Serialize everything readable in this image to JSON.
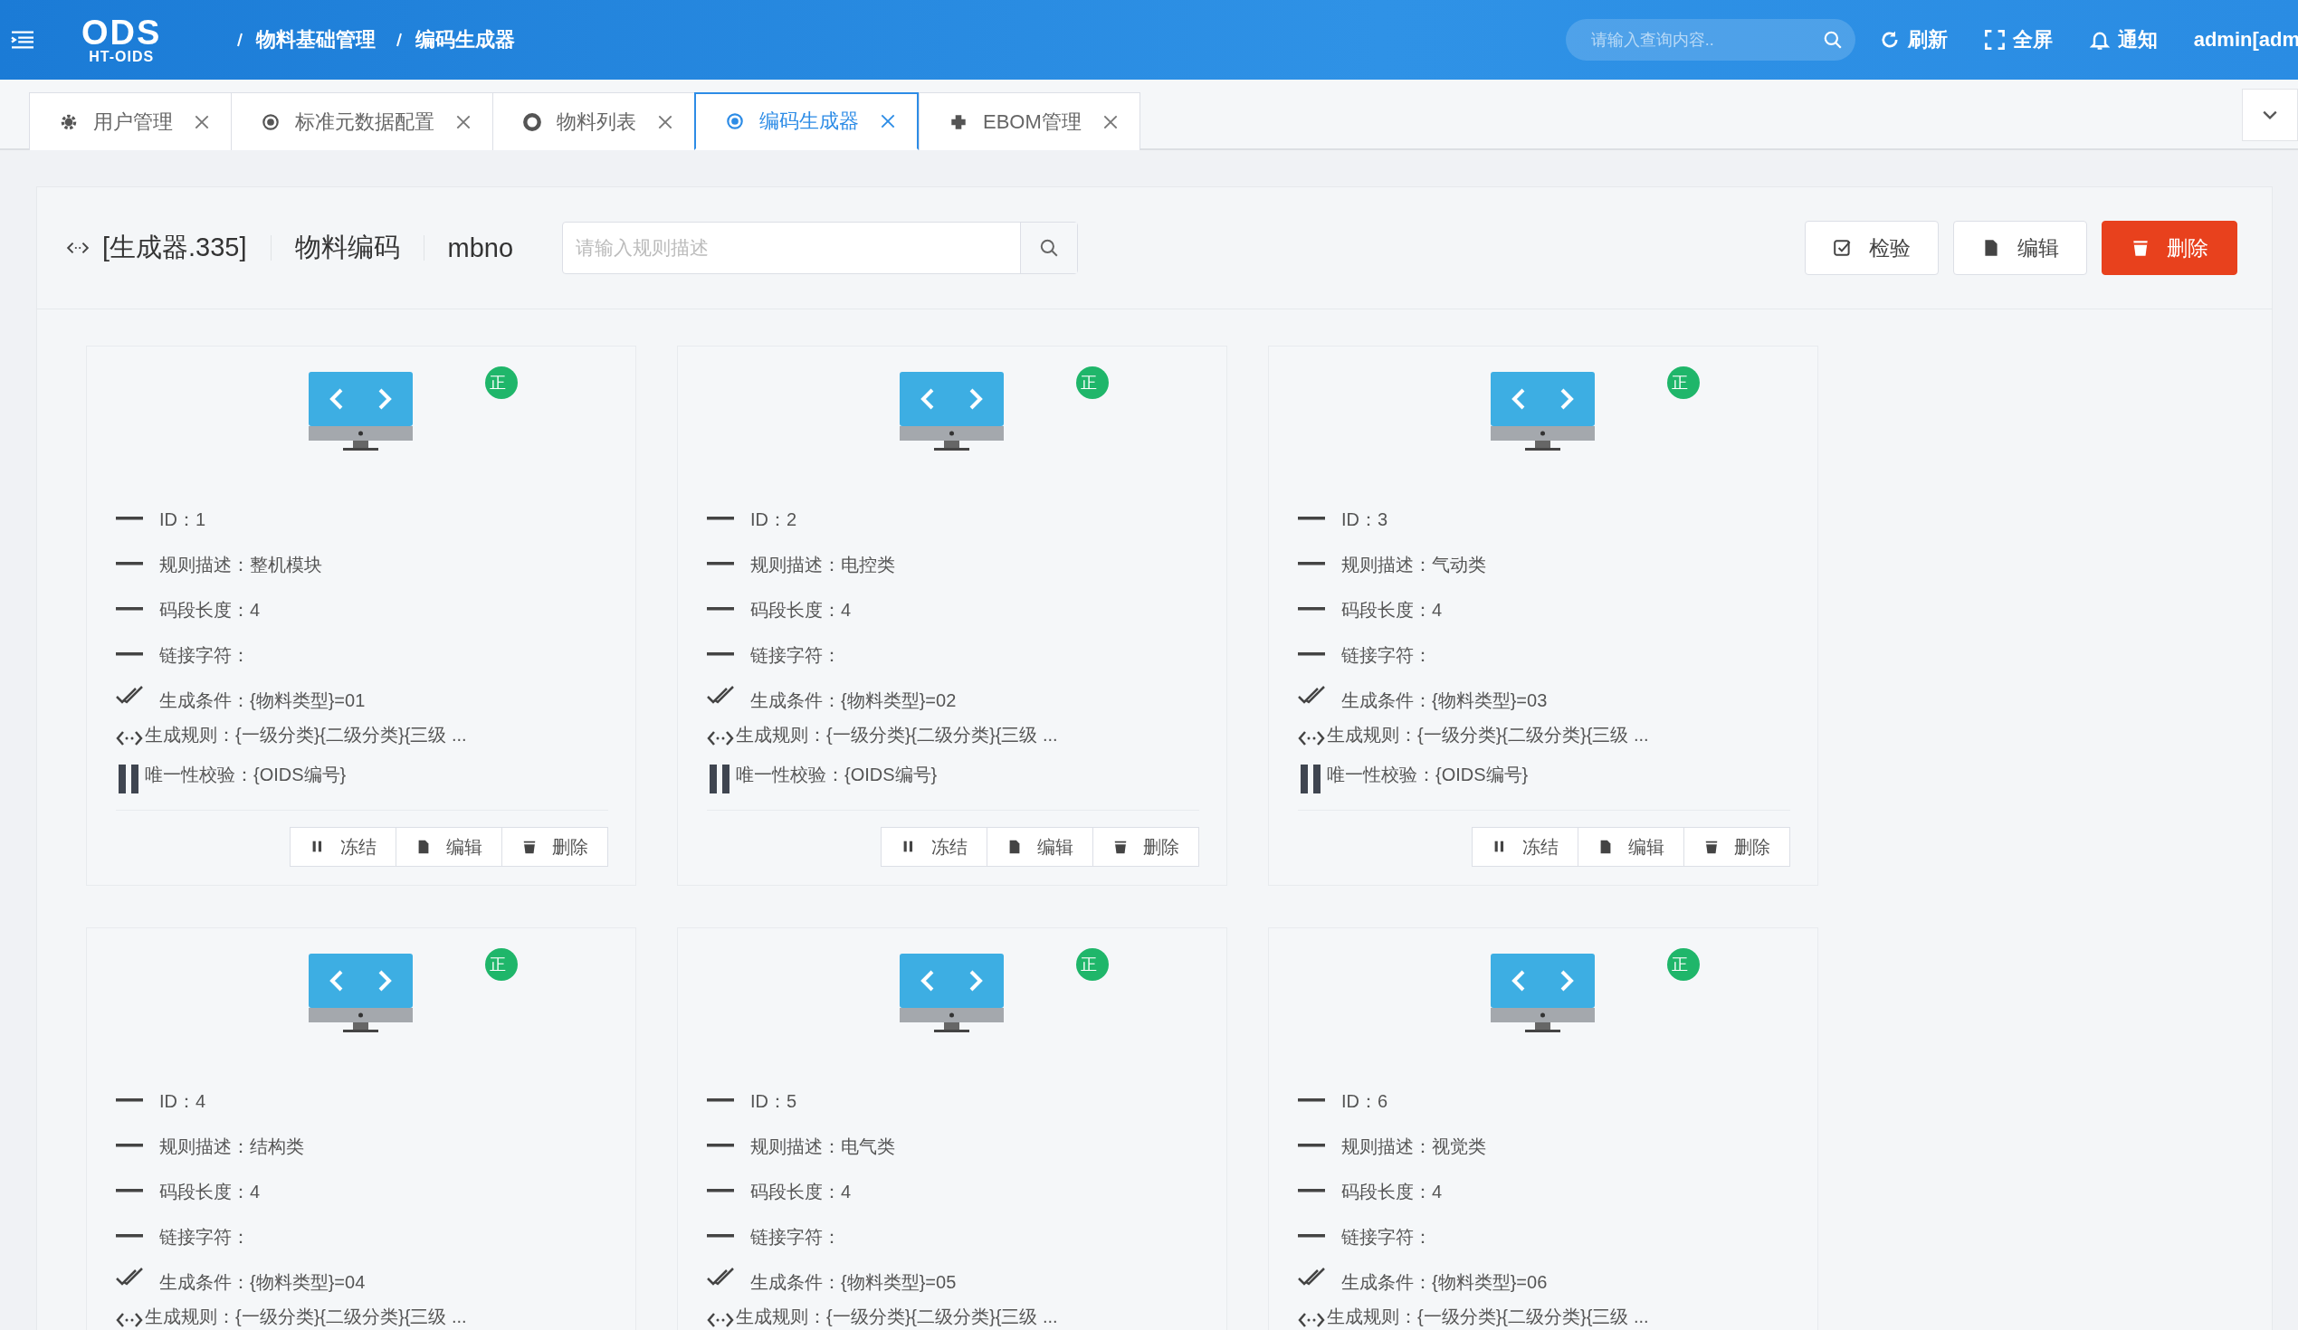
{
  "header": {
    "logo": {
      "main": "ODS",
      "sub": "HT-OIDS"
    },
    "breadcrumb": [
      "物料基础管理",
      "编码生成器"
    ],
    "search": {
      "placeholder": "请输入查询内容.."
    },
    "actions": [
      {
        "kind": "refresh",
        "label": "刷新"
      },
      {
        "kind": "fullscreen",
        "label": "全屏"
      },
      {
        "kind": "bell",
        "label": "通知"
      }
    ],
    "user": "admin[adm"
  },
  "tabs": [
    {
      "label": "用户管理",
      "selected": false
    },
    {
      "label": "标准元数据配置",
      "selected": false
    },
    {
      "label": "物料列表",
      "selected": false
    },
    {
      "label": "编码生成器",
      "selected": true
    },
    {
      "label": "EBOM管理",
      "selected": false
    }
  ],
  "toolbar": {
    "generator": "[生成器.335]",
    "name": "物料编码",
    "code": "mbno",
    "search": {
      "placeholder": "请输入规则描述"
    },
    "buttons": [
      {
        "kind": "check",
        "label": "检验"
      },
      {
        "kind": "edit",
        "label": "编辑"
      },
      {
        "kind": "delete",
        "label": "删除"
      }
    ]
  },
  "cards": [
    {
      "status": "正",
      "fields": [
        {
          "kind": "dash",
          "label": "ID：",
          "value": "1"
        },
        {
          "kind": "dash",
          "label": "规则描述：",
          "value": "整机模块"
        },
        {
          "kind": "dash",
          "label": "码段长度：",
          "value": "4"
        },
        {
          "kind": "dash",
          "label": "链接字符："
        },
        {
          "kind": "check",
          "label": "生成条件：",
          "value": "{物料类型}=01"
        },
        {
          "kind": "code",
          "label": "生成规则：",
          "value": "{一级分类}{二级分类}{三级 ..."
        },
        {
          "kind": "pause",
          "label": "唯一性校验：",
          "value": "{OIDS编号}"
        }
      ],
      "buttons": [
        {
          "kind": "pause",
          "label": "冻结"
        },
        {
          "kind": "edit",
          "label": "编辑"
        },
        {
          "kind": "delete",
          "label": "删除"
        }
      ]
    },
    {
      "status": "正",
      "fields": [
        {
          "kind": "dash",
          "label": "ID：",
          "value": "2"
        },
        {
          "kind": "dash",
          "label": "规则描述：",
          "value": "电控类"
        },
        {
          "kind": "dash",
          "label": "码段长度：",
          "value": "4"
        },
        {
          "kind": "dash",
          "label": "链接字符："
        },
        {
          "kind": "check",
          "label": "生成条件：",
          "value": "{物料类型}=02"
        },
        {
          "kind": "code",
          "label": "生成规则：",
          "value": "{一级分类}{二级分类}{三级 ..."
        },
        {
          "kind": "pause",
          "label": "唯一性校验：",
          "value": "{OIDS编号}"
        }
      ],
      "buttons": [
        {
          "kind": "pause",
          "label": "冻结"
        },
        {
          "kind": "edit",
          "label": "编辑"
        },
        {
          "kind": "delete",
          "label": "删除"
        }
      ]
    },
    {
      "status": "正",
      "fields": [
        {
          "kind": "dash",
          "label": "ID：",
          "value": "3"
        },
        {
          "kind": "dash",
          "label": "规则描述：",
          "value": "气动类"
        },
        {
          "kind": "dash",
          "label": "码段长度：",
          "value": "4"
        },
        {
          "kind": "dash",
          "label": "链接字符："
        },
        {
          "kind": "check",
          "label": "生成条件：",
          "value": "{物料类型}=03"
        },
        {
          "kind": "code",
          "label": "生成规则：",
          "value": "{一级分类}{二级分类}{三级 ..."
        },
        {
          "kind": "pause",
          "label": "唯一性校验：",
          "value": "{OIDS编号}"
        }
      ],
      "buttons": [
        {
          "kind": "pause",
          "label": "冻结"
        },
        {
          "kind": "edit",
          "label": "编辑"
        },
        {
          "kind": "delete",
          "label": "删除"
        }
      ]
    },
    {
      "status": "正",
      "fields": [
        {
          "kind": "dash",
          "label": "ID：",
          "value": "4"
        },
        {
          "kind": "dash",
          "label": "规则描述：",
          "value": "结构类"
        },
        {
          "kind": "dash",
          "label": "码段长度：",
          "value": "4"
        },
        {
          "kind": "dash",
          "label": "链接字符："
        },
        {
          "kind": "check",
          "label": "生成条件：",
          "value": "{物料类型}=04"
        },
        {
          "kind": "code",
          "label": "生成规则：",
          "value": "{一级分类}{二级分类}{三级 ..."
        }
      ]
    },
    {
      "status": "正",
      "fields": [
        {
          "kind": "dash",
          "label": "ID：",
          "value": "5"
        },
        {
          "kind": "dash",
          "label": "规则描述：",
          "value": "电气类"
        },
        {
          "kind": "dash",
          "label": "码段长度：",
          "value": "4"
        },
        {
          "kind": "dash",
          "label": "链接字符："
        },
        {
          "kind": "check",
          "label": "生成条件：",
          "value": "{物料类型}=05"
        },
        {
          "kind": "code",
          "label": "生成规则：",
          "value": "{一级分类}{二级分类}{三级 ..."
        }
      ]
    },
    {
      "status": "正",
      "fields": [
        {
          "kind": "dash",
          "label": "ID：",
          "value": "6"
        },
        {
          "kind": "dash",
          "label": "规则描述：",
          "value": "视觉类"
        },
        {
          "kind": "dash",
          "label": "码段长度：",
          "value": "4"
        },
        {
          "kind": "dash",
          "label": "链接字符："
        },
        {
          "kind": "check",
          "label": "生成条件：",
          "value": "{物料类型}=06"
        },
        {
          "kind": "code",
          "label": "生成规则：",
          "value": "{一级分类}{二级分类}{三级 ..."
        }
      ]
    }
  ]
}
